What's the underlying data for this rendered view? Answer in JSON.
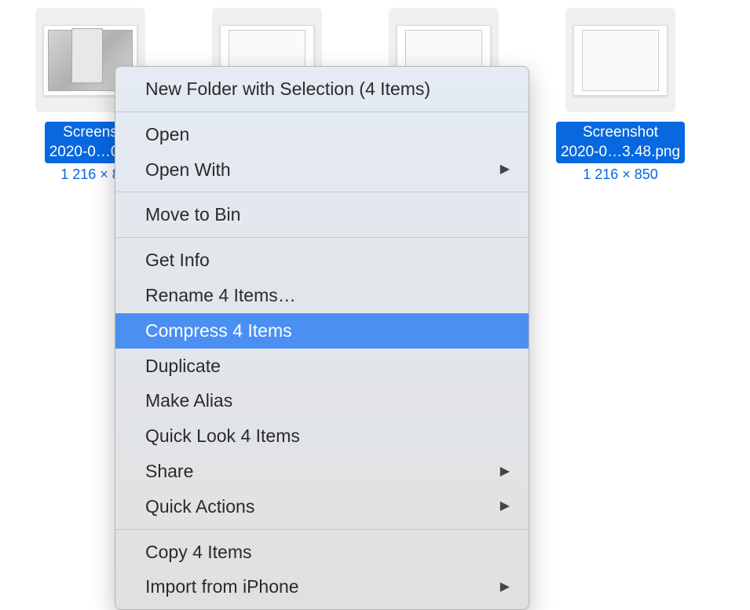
{
  "files": [
    {
      "name": "Screens\n2020-0…0.5",
      "dims": "1 216 × 8"
    },
    {
      "name": "",
      "dims": ""
    },
    {
      "name": "",
      "dims": ""
    },
    {
      "name": "Screenshot\n2020-0…3.48.png",
      "dims": "1 216 × 850"
    }
  ],
  "menu": {
    "new_folder": "New Folder with Selection (4 Items)",
    "open": "Open",
    "open_with": "Open With",
    "move_to_bin": "Move to Bin",
    "get_info": "Get Info",
    "rename": "Rename 4 Items…",
    "compress": "Compress 4 Items",
    "duplicate": "Duplicate",
    "make_alias": "Make Alias",
    "quick_look": "Quick Look 4 Items",
    "share": "Share",
    "quick_actions": "Quick Actions",
    "copy": "Copy 4 Items",
    "import_iphone": "Import from iPhone"
  },
  "arrow": "▶"
}
